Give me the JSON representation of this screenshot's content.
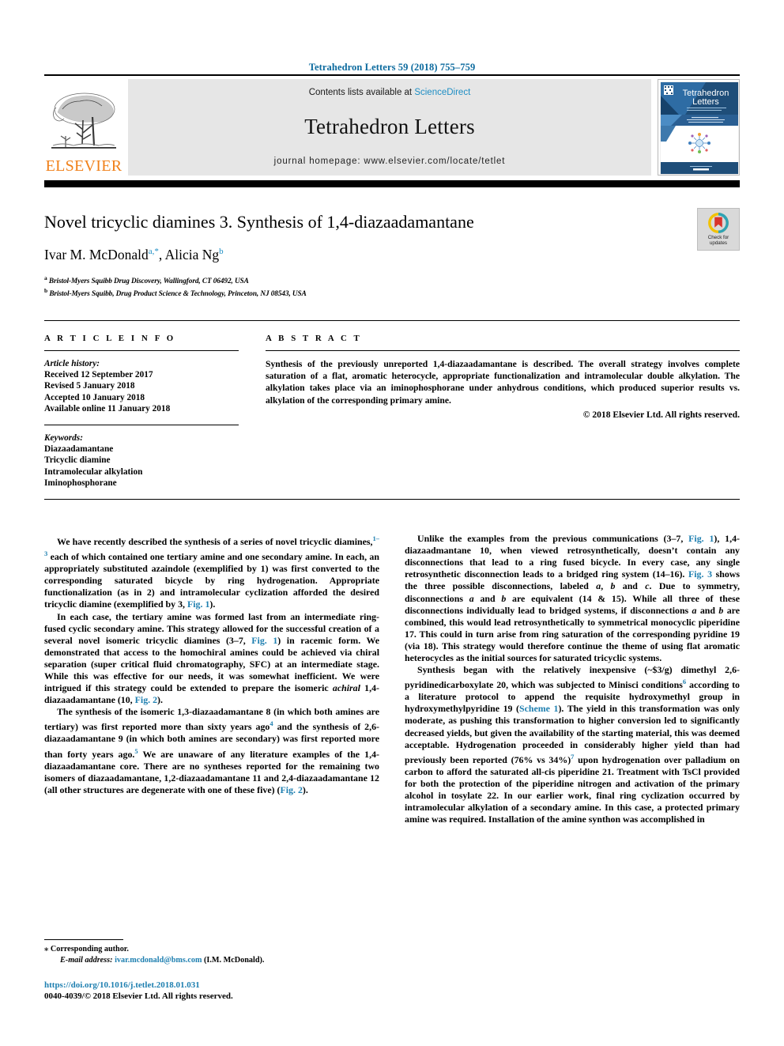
{
  "running_head": "Tetrahedron Letters 59 (2018) 755–759",
  "masthead": {
    "contents_prefix": "Contents lists available at ",
    "sciencedirect": "ScienceDirect",
    "journal_name": "Tetrahedron Letters",
    "homepage": "journal homepage: www.elsevier.com/locate/tetlet",
    "publisher_logo_text": "ELSEVIER",
    "cover_title_line1": "Tetrahedron",
    "cover_title_line2": "Letters"
  },
  "crossmark": {
    "line1": "Check for",
    "line2": "updates"
  },
  "article": {
    "title": "Novel tricyclic diamines 3. Synthesis of 1,4-diazaadamantane",
    "authors_plain": "Ivar M. McDonald a,*, Alicia Ng b",
    "author1": "Ivar M. McDonald",
    "author1_marks": "a,*",
    "author2": "Alicia Ng",
    "author2_marks": "b",
    "affiliation_a": "Bristol-Myers Squibb Drug Discovery, Wallingford, CT 06492, USA",
    "affiliation_b": "Bristol-Myers Squibb, Drug Product Science & Technology, Princeton, NJ 08543, USA",
    "aff_a_marker": "a",
    "aff_b_marker": "b"
  },
  "info": {
    "heading": "A R T I C L E   I N F O",
    "history_label": "Article history:",
    "history": [
      "Received 12 September 2017",
      "Revised 5 January 2018",
      "Accepted 10 January 2018",
      "Available online 11 January 2018"
    ],
    "keywords_label": "Keywords:",
    "keywords": [
      "Diazaadamantane",
      "Tricyclic diamine",
      "Intramolecular alkylation",
      "Iminophosphorane"
    ]
  },
  "abstract": {
    "heading": "A B S T R A C T",
    "text": "Synthesis of the previously unreported 1,4-diazaadamantane is described. The overall strategy involves complete saturation of a flat, aromatic heterocycle, appropriate functionalization and intramolecular double alkylation. The alkylation takes place via an iminophosphorane under anhydrous conditions, which produced superior results vs. alkylation of the corresponding primary amine.",
    "copyright": "© 2018 Elsevier Ltd. All rights reserved."
  },
  "footnote": {
    "star": "⁎",
    "corresponding": "Corresponding author.",
    "email_label": "E-mail address:",
    "email": "ivar.mcdonald@bms.com",
    "email_suffix": "(I.M. McDonald)."
  },
  "footer": {
    "doi": "https://doi.org/10.1016/j.tetlet.2018.01.031",
    "issn": "0040-4039/© 2018 Elsevier Ltd. All rights reserved."
  },
  "colors": {
    "link": "#1e7fb0",
    "sciencedirect": "#1e8ec4",
    "running_head": "#0b6a9e",
    "elsevier_orange": "#f08019",
    "masthead_bg": "#e6e6e6"
  }
}
